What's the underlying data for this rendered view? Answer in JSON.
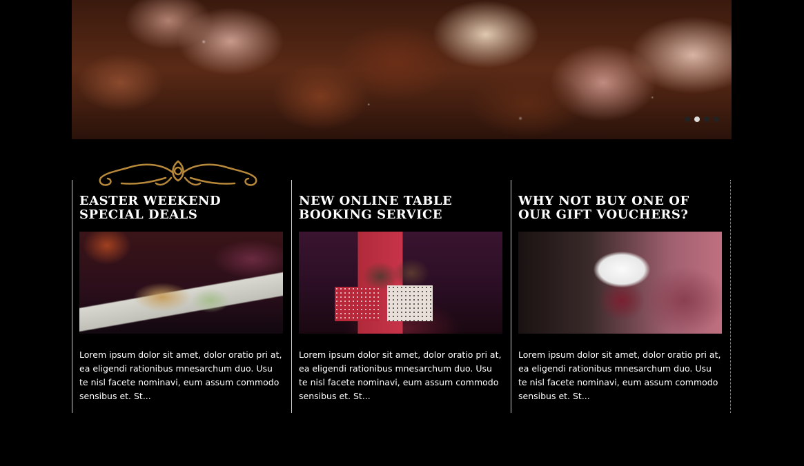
{
  "slider": {
    "dots": [
      {
        "label": "slide-1",
        "active": false
      },
      {
        "label": "slide-2",
        "active": true
      },
      {
        "label": "slide-3",
        "active": false
      },
      {
        "label": "slide-4",
        "active": false
      }
    ]
  },
  "colors": {
    "background": "#000000",
    "ornament": "#b8893a",
    "text": "#ffffff",
    "divider": "#cfcfcf"
  },
  "columns": [
    {
      "title": "Easter Weekend Special Deals",
      "image_icon": "bread-dessert-plate-image",
      "text": "Lorem ipsum dolor sit amet, dolor oratio pri at, ea eligendi rationibus mnesarchum duo. Usu te nisl facete nominavi, eum assum commodo sensibus et. St..."
    },
    {
      "title": "New Online Table Booking Service",
      "image_icon": "cupcakes-image",
      "text": "Lorem ipsum dolor sit amet, dolor oratio pri at, ea eligendi rationibus mnesarchum duo. Usu te nisl facete nominavi, eum assum commodo sensibus et. St..."
    },
    {
      "title": "Why not buy one of our gift vouchers?",
      "image_icon": "ice-cream-sundae-image",
      "text": "Lorem ipsum dolor sit amet, dolor oratio pri at, ea eligendi rationibus mnesarchum duo. Usu te nisl facete nominavi, eum assum commodo sensibus et. St..."
    }
  ]
}
